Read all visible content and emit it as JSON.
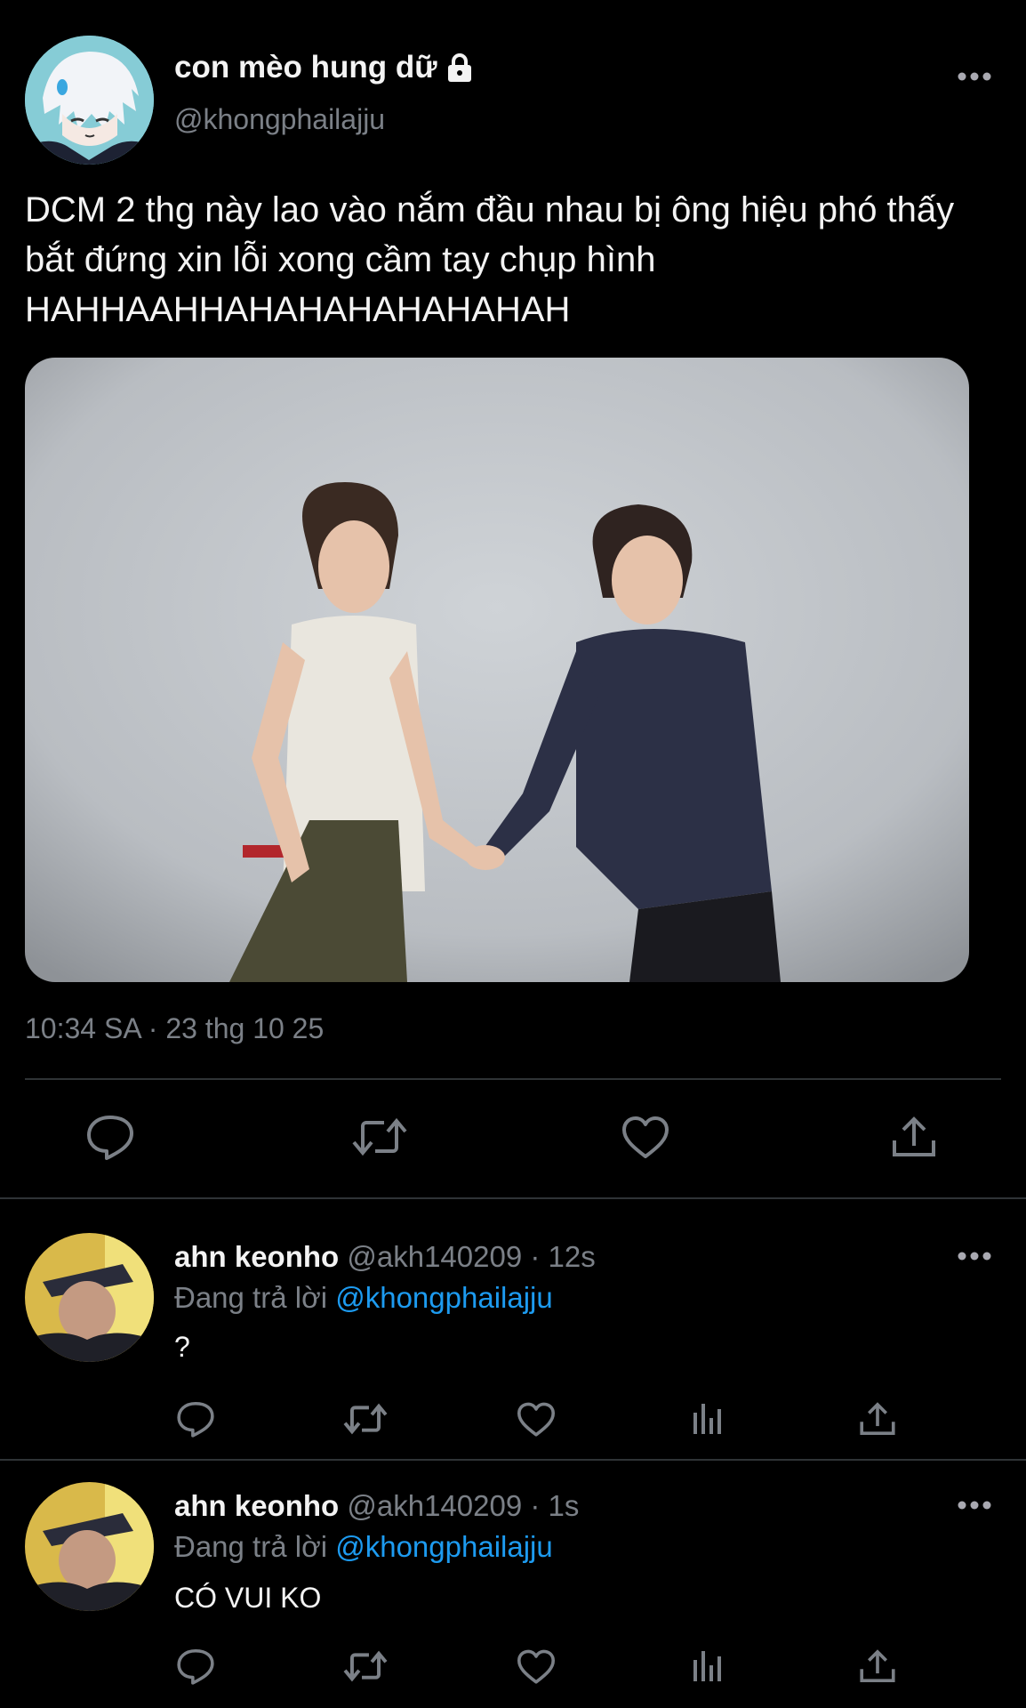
{
  "tweet": {
    "display_name": "con mèo hung dữ",
    "handle": "@khongphailajju",
    "text": "DCM 2 thg này lao vào nắm đầu nhau bị ông hiệu phó thấy bắt đứng xin lỗi xong cầm tay chụp hình HAHHAAHHAHAHAHAHAHAHAH",
    "timestamp": "10:34 SA · 23 thg 10 25",
    "locked_icon": "lock-icon",
    "more_icon": "more-icon",
    "actions": [
      "reply-icon",
      "retweet-icon",
      "like-icon",
      "share-icon"
    ]
  },
  "replies": [
    {
      "display_name": "ahn keonho",
      "meta": "@akh140209 · 12s",
      "replying_prefix": "Đang trả lời ",
      "replying_handle": "@khongphailajju",
      "text": "?"
    },
    {
      "display_name": "ahn keonho",
      "meta": "@akh140209 · 1s",
      "replying_prefix": "Đang trả lời ",
      "replying_handle": "@khongphailajju",
      "text": "CÓ VUI KO"
    }
  ],
  "colors": {
    "background": "#000000",
    "link": "#1d9bf0",
    "muted": "#7b8087",
    "divider": "#2f3336"
  }
}
